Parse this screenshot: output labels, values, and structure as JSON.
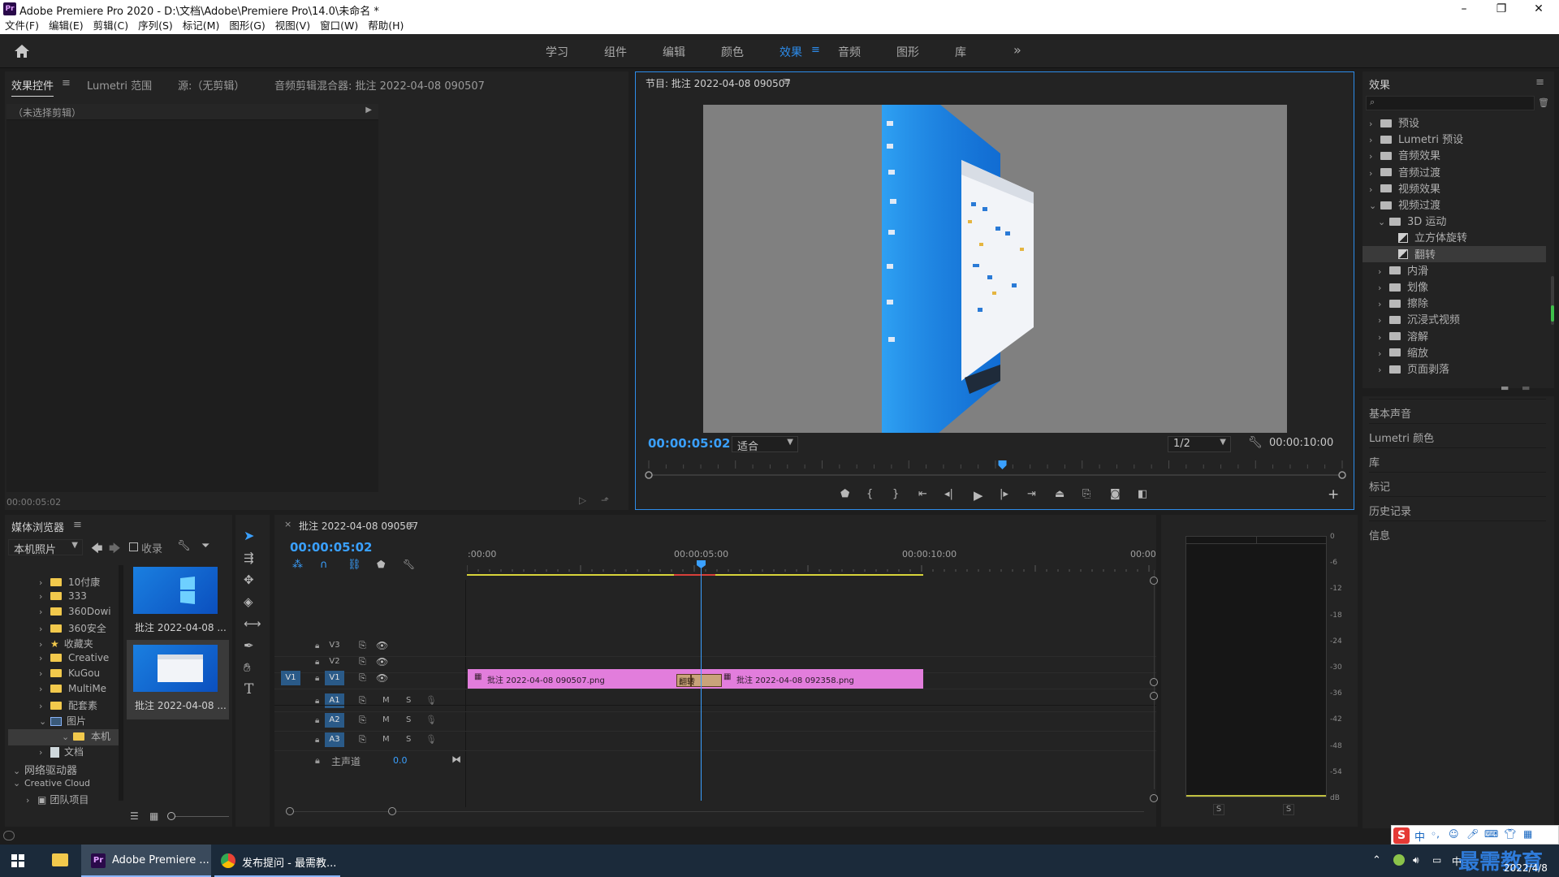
{
  "window": {
    "title": "Adobe Premiere Pro 2020 - D:\\文档\\Adobe\\Premiere Pro\\14.0\\未命名 *",
    "app_icon": "Pr",
    "min": "–",
    "max": "❐",
    "close": "✕"
  },
  "menu": [
    "文件(F)",
    "编辑(E)",
    "剪辑(C)",
    "序列(S)",
    "标记(M)",
    "图形(G)",
    "视图(V)",
    "窗口(W)",
    "帮助(H)"
  ],
  "workspaces": [
    "学习",
    "组件",
    "编辑",
    "颜色",
    "效果",
    "音频",
    "图形",
    "库"
  ],
  "workspace_active": "效果",
  "workspace_more": "»",
  "source_panel": {
    "tabs": [
      "效果控件",
      "Lumetri 范围",
      "源:（无剪辑）",
      "音频剪辑混合器: 批注 2022-04-08 090507"
    ],
    "no_clip": "（未选择剪辑）",
    "timecode": "00:00:05:02"
  },
  "program": {
    "title": "节目: 批注 2022-04-08 090507",
    "timecode": "00:00:05:02",
    "fit": "适合",
    "resolution": "1/2",
    "duration": "00:00:10:00",
    "playhead_fraction": 0.51
  },
  "effects_panel": {
    "title": "效果",
    "search_placeholder": "",
    "tree": [
      {
        "label": "预设",
        "level": 0,
        "open": false,
        "kind": "folder-star"
      },
      {
        "label": "Lumetri 预设",
        "level": 0,
        "open": false,
        "kind": "folder-star"
      },
      {
        "label": "音频效果",
        "level": 0,
        "open": false,
        "kind": "folder"
      },
      {
        "label": "音频过渡",
        "level": 0,
        "open": false,
        "kind": "folder"
      },
      {
        "label": "视频效果",
        "level": 0,
        "open": false,
        "kind": "folder"
      },
      {
        "label": "视频过渡",
        "level": 0,
        "open": true,
        "kind": "folder"
      },
      {
        "label": "3D 运动",
        "level": 1,
        "open": true,
        "kind": "folder"
      },
      {
        "label": "立方体旋转",
        "level": 2,
        "open": false,
        "kind": "item"
      },
      {
        "label": "翻转",
        "level": 2,
        "open": false,
        "kind": "item",
        "selected": true
      },
      {
        "label": "内滑",
        "level": 1,
        "open": false,
        "kind": "folder"
      },
      {
        "label": "划像",
        "level": 1,
        "open": false,
        "kind": "folder"
      },
      {
        "label": "擦除",
        "level": 1,
        "open": false,
        "kind": "folder"
      },
      {
        "label": "沉浸式视频",
        "level": 1,
        "open": false,
        "kind": "folder"
      },
      {
        "label": "溶解",
        "level": 1,
        "open": false,
        "kind": "folder"
      },
      {
        "label": "缩放",
        "level": 1,
        "open": false,
        "kind": "folder"
      },
      {
        "label": "页面剥落",
        "level": 1,
        "open": false,
        "kind": "folder"
      }
    ],
    "sections": [
      "基本声音",
      "Lumetri 颜色",
      "库",
      "标记",
      "历史记录",
      "信息"
    ]
  },
  "media_browser": {
    "title": "媒体浏览器",
    "location": "本机照片",
    "ingest": "收录",
    "tree": [
      {
        "label": "10付康",
        "icon": "yellow"
      },
      {
        "label": "333",
        "icon": "yellow"
      },
      {
        "label": "360Dowi",
        "icon": "yellow"
      },
      {
        "label": "360安全",
        "icon": "yellow"
      },
      {
        "label": "收藏夹",
        "icon": "star"
      },
      {
        "label": "Creative",
        "icon": "yellow"
      },
      {
        "label": "KuGou",
        "icon": "yellow"
      },
      {
        "label": "MultiMe",
        "icon": "yellow"
      },
      {
        "label": "配套素",
        "icon": "yellow"
      },
      {
        "label": "图片",
        "icon": "pictures"
      },
      {
        "label": "本机",
        "icon": "yellow"
      },
      {
        "label": "文档",
        "icon": "doc"
      }
    ],
    "net_drive": "网络驱动器",
    "creative_cloud": "Creative Cloud",
    "team_projects": "团队项目",
    "thumbs": [
      "批注 2022-04-08 ...",
      "批注 2022-04-08 ..."
    ]
  },
  "timeline": {
    "title": "批注 2022-04-08 090507",
    "timecode": "00:00:05:02",
    "ruler": [
      ":00:00",
      "00:00:05:00",
      "00:00:10:00",
      "00:00"
    ],
    "video_tracks": [
      "V3",
      "V2",
      "V1"
    ],
    "audio_tracks": [
      "A1",
      "A2",
      "A3"
    ],
    "master": "主声道",
    "master_value": "0.0",
    "source_patch": "V1",
    "clip1": "批注 2022-04-08 090507.png",
    "clip2": "批注 2022-04-08 092358.png",
    "transition": "翻转",
    "m": "M",
    "s": "S"
  },
  "meter": {
    "scale": [
      "0",
      "-6",
      "-12",
      "-18",
      "-24",
      "-30",
      "-36",
      "-42",
      "-48",
      "-54",
      "dB"
    ],
    "solo": [
      "S",
      "S"
    ]
  },
  "taskbar": {
    "apps": [
      "Adobe Premiere ...",
      "发布提问 - 最需教..."
    ],
    "date": "2022/4/8",
    "watermark": "最需教育",
    "ime": "中"
  },
  "colors": {
    "accent": "#2d8ceb",
    "clip": "#e27ddc",
    "transition": "#c9a37a",
    "timecode": "#3aa0ff"
  }
}
